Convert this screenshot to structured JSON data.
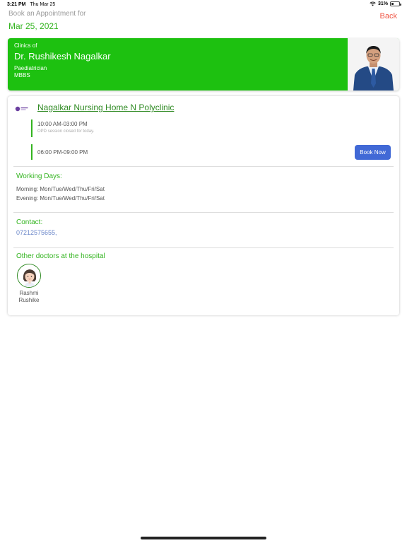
{
  "status_bar": {
    "time": "3:21 PM",
    "date": "Thu Mar 25",
    "battery": "31%",
    "battery_level": 0.31
  },
  "header": {
    "subtitle": "Book an Appointment for",
    "date": "Mar 25, 2021",
    "back_label": "Back"
  },
  "doctor": {
    "clinics_label": "Clinics of",
    "name": "Dr. Rushikesh Nagalkar",
    "specialty": "Paediatrician",
    "degree": "MBBS"
  },
  "clinic": {
    "name": "Nagalkar Nursing Home N Polyclinic",
    "sessions": [
      {
        "time": "10:00 AM-03:00 PM",
        "note": "OPD session closed for today."
      },
      {
        "time": "06:00 PM-09:00 PM"
      }
    ],
    "book_label": "Book Now",
    "working_days_title": "Working Days:",
    "morning": "Morning: Mon/Tue/Wed/Thu/Fri/Sat",
    "evening": "Evening: Mon/Tue/Wed/Thu/Fri/Sat",
    "contact_title": "Contact:",
    "phone": "07212575655,",
    "other_doctors_title": "Other doctors at the hospital",
    "other_doctors": [
      {
        "first": "Rashmi",
        "last": "Rushike"
      }
    ]
  },
  "colors": {
    "accent_green": "#1dc110",
    "text_green": "#33b41f",
    "back_red": "#f05a4a",
    "button_blue": "#4169d6",
    "link_blue": "#6a86c9"
  }
}
